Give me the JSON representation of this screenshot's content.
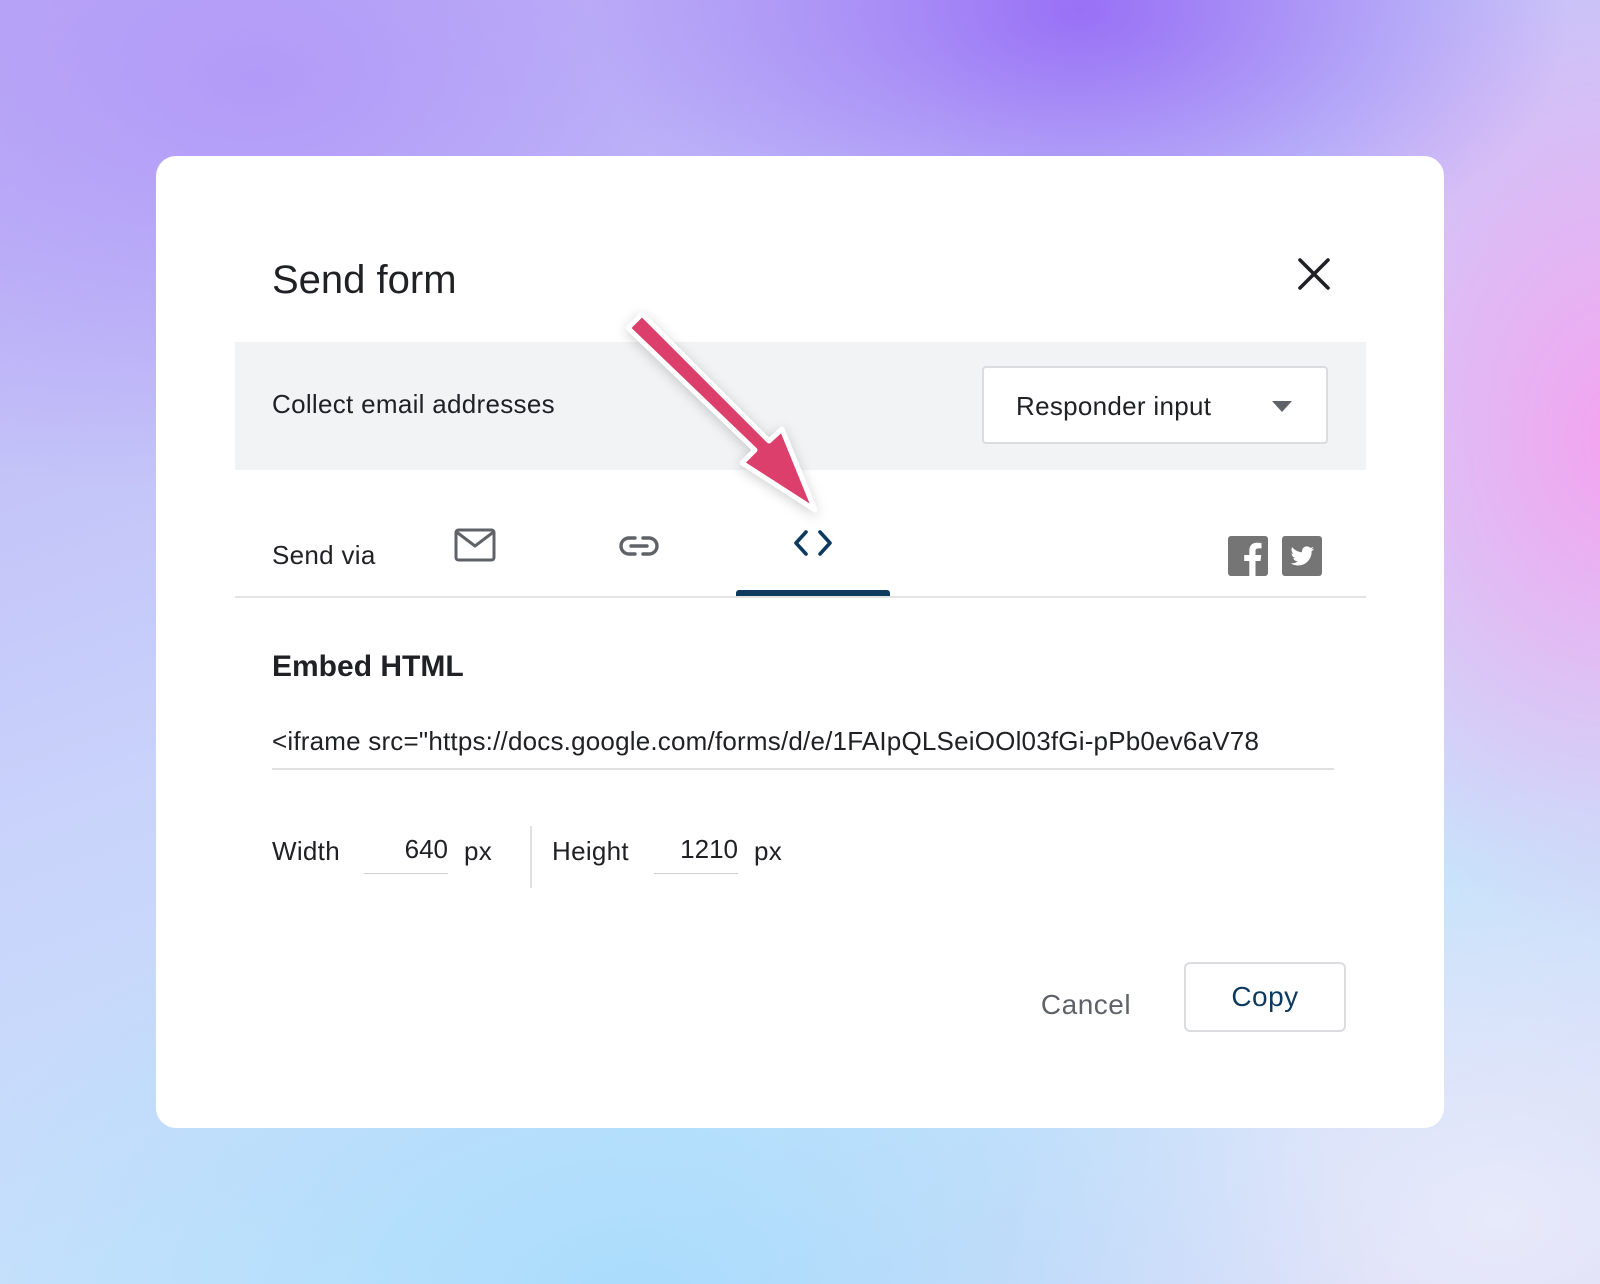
{
  "dialog": {
    "title": "Send form"
  },
  "collect": {
    "label": "Collect email addresses",
    "selected_option": "Responder input"
  },
  "send_via": {
    "label": "Send via",
    "tabs": [
      {
        "icon": "email-icon"
      },
      {
        "icon": "link-icon"
      },
      {
        "icon": "embed-code-icon",
        "active": true
      }
    ],
    "social": [
      "facebook-icon",
      "twitter-icon"
    ]
  },
  "embed": {
    "title": "Embed HTML",
    "code": "<iframe src=\"https://docs.google.com/forms/d/e/1FAIpQLSeiOOl03fGi-pPb0ev6aV78"
  },
  "dimensions": {
    "width_label": "Width",
    "width_value": "640",
    "height_label": "Height",
    "height_value": "1210",
    "unit": "px"
  },
  "actions": {
    "cancel_label": "Cancel",
    "copy_label": "Copy"
  },
  "colors": {
    "accent": "#0e3a5f",
    "annotation_arrow": "#dc3f6b",
    "muted_gray": "#5f6368",
    "panel_gray": "#f1f3f4"
  }
}
